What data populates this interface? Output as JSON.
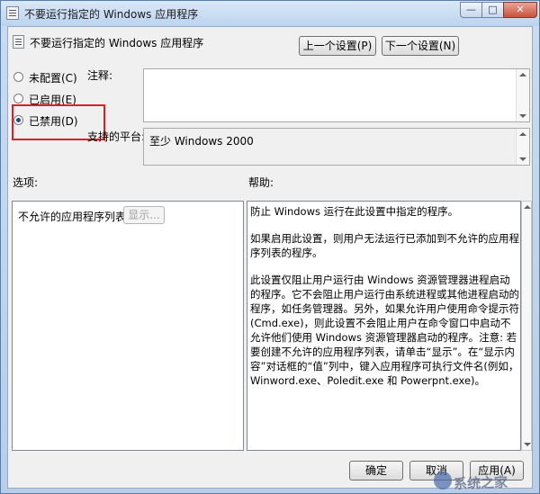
{
  "window": {
    "title": "不要运行指定的 Windows 应用程序",
    "min_glyph": "—",
    "max_glyph": "□",
    "close_glyph": "✕"
  },
  "header": {
    "policy_title": "不要运行指定的 Windows 应用程序",
    "prev_label": "上一个设置(P)",
    "next_label": "下一个设置(N)"
  },
  "state": {
    "options": [
      {
        "label": "未配置(C)",
        "checked": false
      },
      {
        "label": "已启用(E)",
        "checked": false
      },
      {
        "label": "已禁用(D)",
        "checked": true
      }
    ]
  },
  "comment": {
    "label": "注释:",
    "value": ""
  },
  "platform": {
    "label": "支持的平台:",
    "value": "至少 Windows 2000"
  },
  "options_section": {
    "label": "选项:",
    "list_label": "不允许的应用程序列表",
    "show_label": "显示..."
  },
  "help_section": {
    "label": "帮助:",
    "paragraphs": [
      "防止 Windows 运行在此设置中指定的程序。",
      "如果启用此设置，则用户无法运行已添加到不允许的应用程序列表的程序。",
      "此设置仅阻止用户运行由 Windows 资源管理器进程启动的程序。它不会阻止用户运行由系统进程或其他进程启动的程序，如任务管理器。另外，如果允许用户使用命令提示符(Cmd.exe)，则此设置不会阻止用户在命令窗口中启动不允许他们使用 Windows 资源管理器启动的程序。注意: 若要创建不允许的应用程序列表，请单击“显示”。在“显示内容”对话框的“值”列中，键入应用程序可执行文件名(例如，Winword.exe、Poledit.exe 和 Powerpnt.exe)。"
    ]
  },
  "footer": {
    "ok_label": "确定",
    "cancel_label": "取消",
    "apply_label": "应用(A)"
  },
  "watermark": {
    "text": "系统之家"
  },
  "colors": {
    "highlight": "#e31c1c",
    "title_gradient_top": "#d9e8f8"
  }
}
